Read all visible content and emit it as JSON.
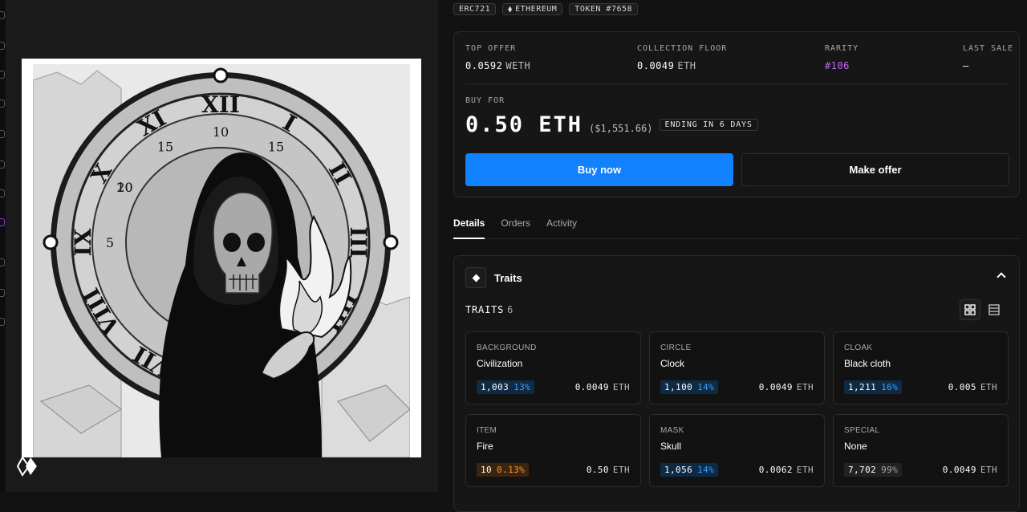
{
  "chips": {
    "standard": "ERC721",
    "chain": "ETHEREUM",
    "token": "TOKEN #7658"
  },
  "stats": {
    "top_offer": {
      "label": "TOP OFFER",
      "value": "0.0592",
      "unit": "WETH"
    },
    "collection_floor": {
      "label": "COLLECTION FLOOR",
      "value": "0.0049",
      "unit": "ETH"
    },
    "rarity": {
      "label": "RARITY",
      "value": "#106"
    },
    "last_sale": {
      "label": "LAST SALE",
      "value": "—"
    }
  },
  "buy": {
    "label": "BUY FOR",
    "price": "0.50 ETH",
    "usd": "($1,551.66)",
    "ending": "ENDING IN 6 DAYS",
    "buy_now": "Buy now",
    "make_offer": "Make offer"
  },
  "tabs": [
    "Details",
    "Orders",
    "Activity"
  ],
  "traits": {
    "title": "Traits",
    "count_label": "TRAITS",
    "count": "6",
    "items": [
      {
        "type": "BACKGROUND",
        "value": "Civilization",
        "count": "1,003",
        "pct": "13%",
        "price": "0.0049",
        "unit": "ETH"
      },
      {
        "type": "CIRCLE",
        "value": "Clock",
        "count": "1,100",
        "pct": "14%",
        "price": "0.0049",
        "unit": "ETH"
      },
      {
        "type": "CLOAK",
        "value": "Black cloth",
        "count": "1,211",
        "pct": "16%",
        "price": "0.005",
        "unit": "ETH"
      },
      {
        "type": "ITEM",
        "value": "Fire",
        "count": "10",
        "pct": "0.13%",
        "price": "0.50",
        "unit": "ETH"
      },
      {
        "type": "MASK",
        "value": "Skull",
        "count": "1,056",
        "pct": "14%",
        "price": "0.0062",
        "unit": "ETH"
      },
      {
        "type": "SPECIAL",
        "value": "None",
        "count": "7,702",
        "pct": "99%",
        "price": "0.0049",
        "unit": "ETH"
      }
    ]
  },
  "art": {
    "numerals": [
      "XII",
      "I",
      "II",
      "III",
      "IIII",
      "V",
      "VI",
      "VII",
      "VIII",
      "IX",
      "X",
      "XI"
    ],
    "minute_marks": [
      "10",
      "15",
      "20",
      "5",
      "15",
      "10"
    ]
  },
  "colors": {
    "accent": "#1181ff",
    "rarity": "#c964ff",
    "pct_blue": "#3ea0ff",
    "pct_orange": "#ff9a2e"
  }
}
